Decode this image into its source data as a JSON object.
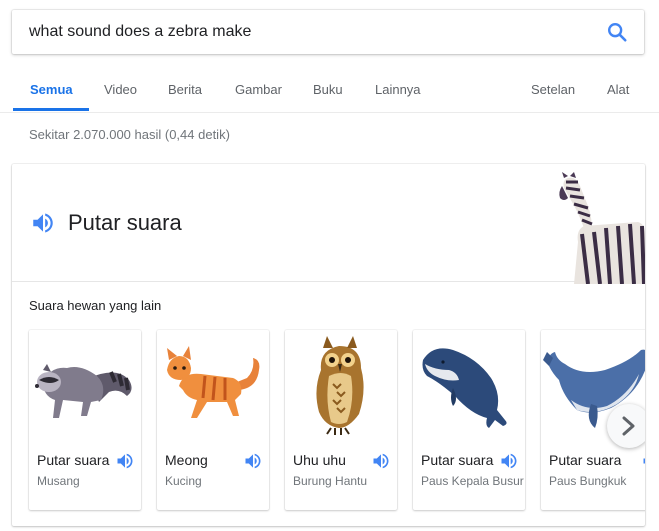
{
  "search": {
    "query": "what sound does a zebra make"
  },
  "tabs": [
    {
      "label": "Semua",
      "active": true
    },
    {
      "label": "Video"
    },
    {
      "label": "Berita"
    },
    {
      "label": "Gambar"
    },
    {
      "label": "Buku"
    },
    {
      "label": "Lainnya"
    },
    {
      "label": "Setelan"
    },
    {
      "label": "Alat"
    }
  ],
  "result_stats": "Sekitar 2.070.000 hasil (0,44 detik)",
  "card": {
    "play_label": "Putar suara",
    "other_title": "Suara hewan yang lain",
    "animals": [
      {
        "sound": "Putar suara",
        "name": "Musang",
        "icon": "raccoon-image"
      },
      {
        "sound": "Meong",
        "name": "Kucing",
        "icon": "cat-image"
      },
      {
        "sound": "Uhu uhu",
        "name": "Burung Hantu",
        "icon": "owl-image"
      },
      {
        "sound": "Putar suara",
        "name": "Paus Kepala Busur",
        "icon": "bowhead-whale-image"
      },
      {
        "sound": "Putar suara",
        "name": "Paus Bungkuk",
        "icon": "humpback-whale-image"
      }
    ]
  },
  "colors": {
    "accent": "#1a73e8",
    "speaker": "#4285f4"
  }
}
